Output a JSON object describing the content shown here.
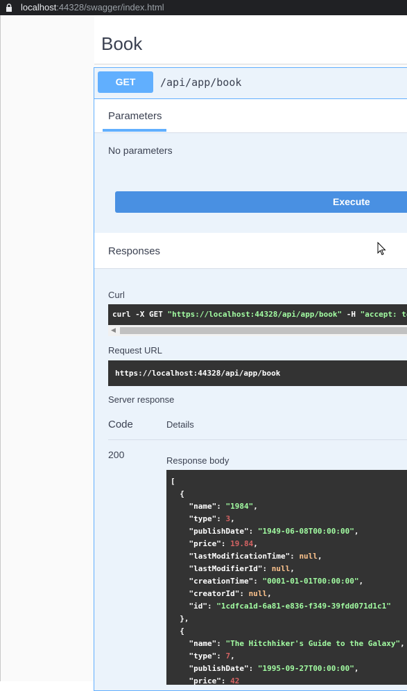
{
  "browser": {
    "url_host": "localhost",
    "url_rest": ":44328/swagger/index.html"
  },
  "section": {
    "title": "Book"
  },
  "operation": {
    "method": "GET",
    "path": "/api/app/book",
    "params_tab": "Parameters",
    "no_params": "No parameters",
    "execute_label": "Execute"
  },
  "responses": {
    "title": "Responses",
    "curl_label": "Curl",
    "curl": {
      "prefix": "curl -X GET ",
      "url": "\"https://localhost:44328/api/app/book\"",
      "middle": " -H  ",
      "accept": "\"accept: text/plain\""
    },
    "request_url_label": "Request URL",
    "request_url": "https://localhost:44328/api/app/book",
    "server_response_label": "Server response",
    "code_header": "Code",
    "details_header": "Details",
    "code": "200",
    "response_body_label": "Response body"
  },
  "response_body": [
    {
      "name": "\"1984\"",
      "type": "3",
      "publishDate": "\"1949-06-08T00:00:00\"",
      "price": "19.84",
      "lastModificationTime": "null",
      "lastModifierId": "null",
      "creationTime": "\"0001-01-01T00:00:00\"",
      "creatorId": "null",
      "id": "\"1cdfca1d-6a81-e836-f349-39fdd071d1c1\""
    },
    {
      "name": "\"The Hitchhiker's Guide to the Galaxy\"",
      "type": "7",
      "publishDate": "\"1995-09-27T00:00:00\"",
      "price": "42"
    }
  ]
}
